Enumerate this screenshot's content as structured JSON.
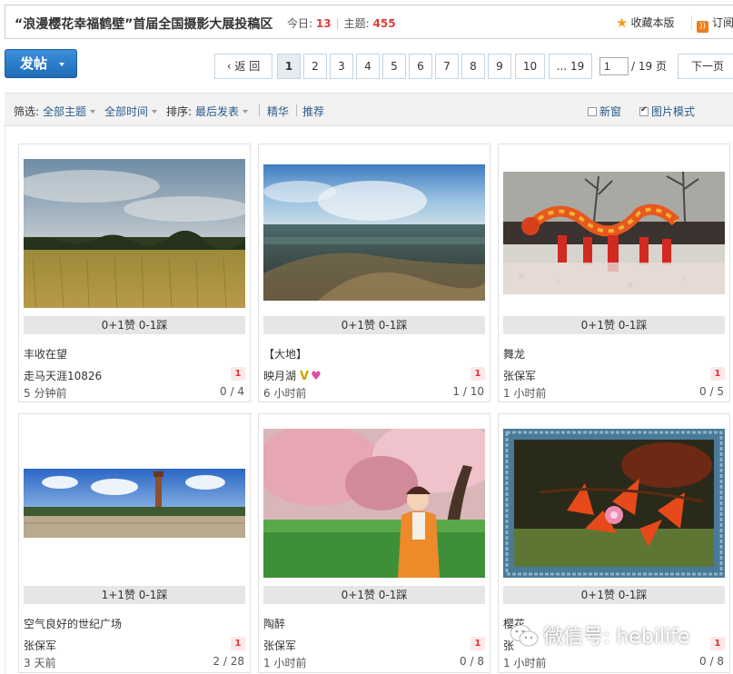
{
  "header": {
    "forum_title": "“浪漫樱花幸福鹤壁”首届全国摄影大展投稿区",
    "today_label": "今日:",
    "today_count": "13",
    "topics_label": "主题:",
    "topics_count": "455",
    "favorite_label": "收藏本版",
    "rss_label": "订阅"
  },
  "toolbar": {
    "post_label": "发帖"
  },
  "pagination": {
    "back_label": "返 回",
    "pages": [
      "1",
      "2",
      "3",
      "4",
      "5",
      "6",
      "7",
      "8",
      "9",
      "10"
    ],
    "ellipsis_last": "... 19",
    "current_page_value": "1",
    "total_label": "/ 19 页",
    "next_label": "下一页"
  },
  "filter": {
    "filter_label": "筛选:",
    "all_topics": "全部主题",
    "all_time": "全部时间",
    "sort_label": "排序:",
    "last_post": "最后发表",
    "digest": "精华",
    "recommend": "推荐",
    "new_window": "新窗",
    "image_mode": "图片模式"
  },
  "cards": [
    {
      "vote": "0+1赞 0-1踩",
      "title": "丰收在望",
      "author": "走马天涯10826",
      "badge": "1",
      "time": "5 分钟前",
      "counts": "0 / 4"
    },
    {
      "vote": "0+1赞 0-1踩",
      "title": "【大地】",
      "author": "映月湖",
      "badge": "1",
      "time": "6 小时前",
      "counts": "1 / 10"
    },
    {
      "vote": "0+1赞 0-1踩",
      "title": "舞龙",
      "author": "张保军",
      "badge": "1",
      "time": "1 小时前",
      "counts": "0 / 5"
    },
    {
      "vote": "1+1赞 0-1踩",
      "title": "空气良好的世纪广场",
      "author": "张保军",
      "badge": "1",
      "time": "3 天前",
      "counts": "2 / 28"
    },
    {
      "vote": "0+1赞 0-1踩",
      "title": "陶醉",
      "author": "张保军",
      "badge": "1",
      "time": "1 小时前",
      "counts": "0 / 8"
    },
    {
      "vote": "0+1赞 0-1踩",
      "title": "樱花",
      "author": "张",
      "badge": "1",
      "time": "1 小时前",
      "counts": "0 / 8"
    }
  ],
  "watermark": {
    "text": "微信号: hebilife"
  },
  "colors": {
    "accent_blue": "#1f6cb8",
    "count_red": "#e03c3c",
    "link_blue": "#2b5a8c"
  }
}
